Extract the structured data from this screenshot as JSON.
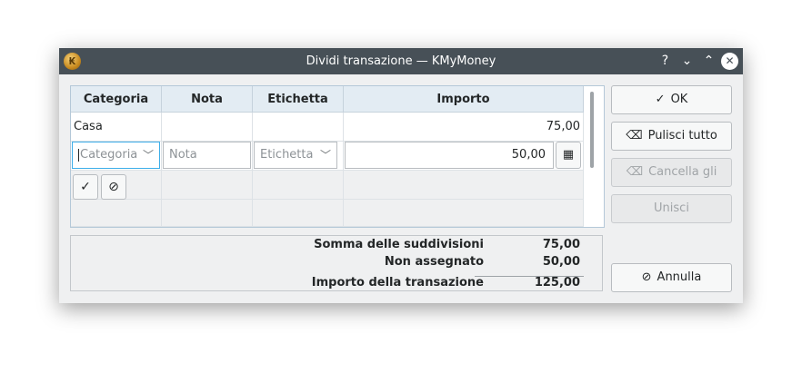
{
  "window": {
    "title": "Dividi transazione — KMyMoney",
    "help_glyph": "?",
    "minimize_glyph": "⌄",
    "maximize_glyph": "⌃",
    "close_glyph": "✕"
  },
  "table": {
    "headers": [
      "Categoria",
      "Nota",
      "Etichetta",
      "Importo"
    ],
    "rows": [
      {
        "category": "Casa",
        "note": "",
        "tag": "",
        "amount": "75,00"
      }
    ],
    "edit_row": {
      "category_placeholder": "Categoria",
      "note_placeholder": "Nota",
      "tag_placeholder": "Etichetta",
      "amount_value": "50,00"
    },
    "confirm_glyph": "✓",
    "cancel_glyph": "⊘",
    "calculator_glyph": "▦"
  },
  "summary": {
    "splits_label": "Somma delle suddivisioni",
    "splits_value": "75,00",
    "unassigned_label": "Non assegnato",
    "unassigned_value": "50,00",
    "total_label": "Importo della transazione",
    "total_value": "125,00"
  },
  "buttons": {
    "ok": "OK",
    "ok_glyph": "✓",
    "clear_all": "Pulisci tutto",
    "clear_glyph": "⌫",
    "clear_zero": "Cancella gli zero",
    "merge": "Unisci",
    "cancel": "Annulla",
    "cancel_glyph": "⊘"
  },
  "colors": {
    "titlebar": "#475057",
    "header_bg": "#e3ecf3",
    "focus_border": "#3daee9",
    "window_bg": "#eff0f1"
  }
}
